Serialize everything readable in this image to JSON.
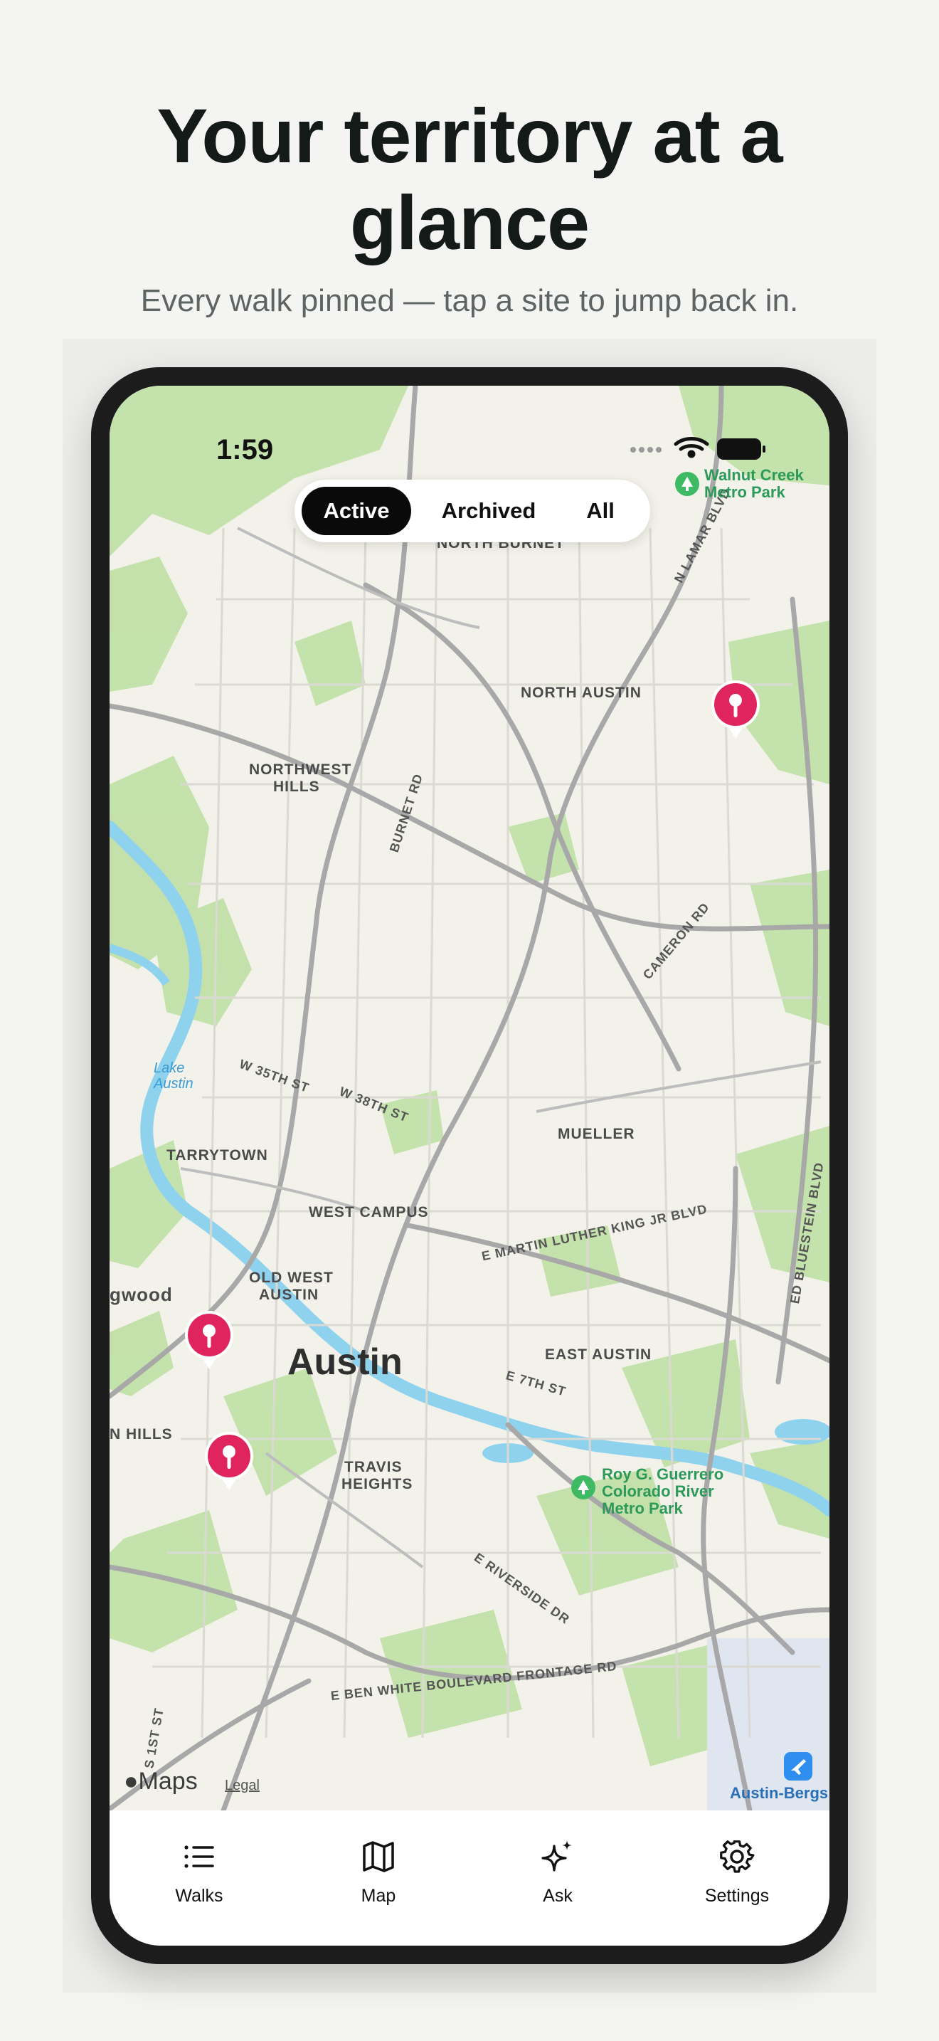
{
  "hero": {
    "title_line1": "Your territory at a",
    "title_line2": "glance",
    "subtitle": "Every walk pinned — tap a site to jump back in."
  },
  "status_bar": {
    "time": "1:59"
  },
  "filter": {
    "options": [
      "Active",
      "Archived",
      "All"
    ],
    "selected": "Active"
  },
  "map": {
    "city": "Austin",
    "neighborhoods": [
      "NORTH BURNET",
      "NORTH AUSTIN",
      "NORTHWEST",
      "HILLS",
      "TARRYTOWN",
      "WEST CAMPUS",
      "OLD WEST",
      "AUSTIN",
      "MUELLER",
      "EAST AUSTIN",
      "TRAVIS",
      "HEIGHTS",
      "gwood",
      "N HILLS"
    ],
    "roads": [
      "N LAMAR BLVD",
      "BURNET RD",
      "CAMERON RD",
      "W 35TH ST",
      "W 38TH ST",
      "E MARTIN LUTHER KING JR BLVD",
      "E 7TH ST",
      "E RIVERSIDE DR",
      "E BEN WHITE BOULEVARD FRONTAGE RD",
      "ED BLUESTEIN BLVD",
      "S 1ST ST"
    ],
    "parks": [
      "Walnut Creek",
      "Metro Park",
      "Roy G. Guerrero",
      "Colorado River",
      "Metro Park"
    ],
    "water": [
      "Lake",
      "Austin"
    ],
    "airport": "Austin-Bergs",
    "attribution": "Maps",
    "legal": "Legal",
    "pin_count": 3,
    "colors": {
      "pin": "#e0245e",
      "land": "#f3f2ea",
      "green": "#b9dd9f",
      "water": "#8fd2ee",
      "road": "#a9a9a9"
    }
  },
  "tabs": [
    {
      "label": "Walks",
      "icon": "list-icon"
    },
    {
      "label": "Map",
      "icon": "map-icon"
    },
    {
      "label": "Ask",
      "icon": "sparkles-icon"
    },
    {
      "label": "Settings",
      "icon": "gear-icon"
    }
  ]
}
